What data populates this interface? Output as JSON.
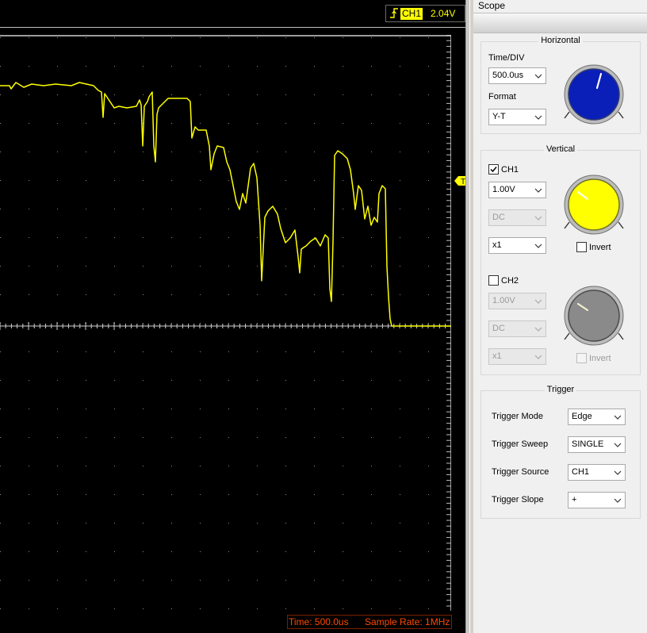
{
  "header": {
    "channel_label": "CH1",
    "trigger_level": "2.04V"
  },
  "status": {
    "time_text": "Time: 500.0us",
    "sample_rate_text": "Sample Rate: 1MHz"
  },
  "trigger_marker": "T",
  "panel": {
    "title": "Scope",
    "horizontal": {
      "title": "Horizontal",
      "time_div_label": "Time/DIV",
      "time_div_value": "500.0us",
      "format_label": "Format",
      "format_value": "Y-T"
    },
    "vertical": {
      "title": "Vertical",
      "ch1": {
        "label": "CH1",
        "checked": true,
        "volts_value": "1.00V",
        "coupling_value": "DC",
        "probe_value": "x1",
        "invert_label": "Invert",
        "invert_checked": false
      },
      "ch2": {
        "label": "CH2",
        "checked": false,
        "volts_value": "1.00V",
        "coupling_value": "DC",
        "probe_value": "x1",
        "invert_label": "Invert",
        "invert_checked": false
      }
    },
    "trigger": {
      "title": "Trigger",
      "mode_label": "Trigger Mode",
      "mode_value": "Edge",
      "sweep_label": "Trigger Sweep",
      "sweep_value": "SINGLE",
      "source_label": "Trigger Source",
      "source_value": "CH1",
      "slope_label": "Trigger Slope",
      "slope_value": "+"
    }
  },
  "colors": {
    "trace": "#ffff00",
    "ch1_knob": "#ffff00",
    "time_knob": "#0a1fb8",
    "ch2_knob": "#8a8a8a",
    "status_text": "#ff4a00"
  }
}
